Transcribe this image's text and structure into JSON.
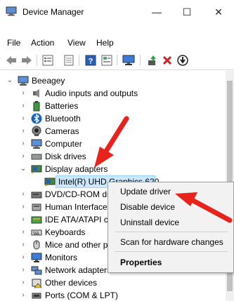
{
  "window": {
    "title": "Device Manager",
    "minimize": "—",
    "maximize": "☐",
    "close": "✕"
  },
  "menu": [
    "File",
    "Action",
    "View",
    "Help"
  ],
  "toolbar": {
    "icons": [
      "back-icon",
      "forward-icon",
      "properties-icon",
      "scan-icon",
      "help-icon",
      "details-icon",
      "monitor-icon",
      "update-driver-icon",
      "uninstall-icon",
      "download-icon"
    ]
  },
  "tree": {
    "root": "Beeagey",
    "items": [
      {
        "label": "Audio inputs and outputs",
        "icon": "speaker-icon"
      },
      {
        "label": "Batteries",
        "icon": "battery-icon"
      },
      {
        "label": "Bluetooth",
        "icon": "bluetooth-icon"
      },
      {
        "label": "Cameras",
        "icon": "camera-icon"
      },
      {
        "label": "Computer",
        "icon": "computer-icon"
      },
      {
        "label": "Disk drives",
        "icon": "disk-icon"
      },
      {
        "label": "Display adapters",
        "icon": "display-adapter-icon",
        "expanded": true
      },
      {
        "label": "Intel(R) UHD Graphics 620",
        "icon": "display-adapter-icon",
        "child": true,
        "selected": true
      },
      {
        "label": "DVD/CD-ROM drives",
        "icon": "dvd-icon"
      },
      {
        "label": "Human Interface Devices",
        "icon": "hid-icon"
      },
      {
        "label": "IDE ATA/ATAPI controllers",
        "icon": "ide-icon"
      },
      {
        "label": "Keyboards",
        "icon": "keyboard-icon"
      },
      {
        "label": "Mice and other pointing devices",
        "icon": "mouse-icon"
      },
      {
        "label": "Monitors",
        "icon": "monitor-icon"
      },
      {
        "label": "Network adapters",
        "icon": "network-icon"
      },
      {
        "label": "Other devices",
        "icon": "other-devices-icon"
      },
      {
        "label": "Ports (COM & LPT)",
        "icon": "ports-icon"
      }
    ]
  },
  "context_menu": {
    "update_driver": "Update driver",
    "disable_device": "Disable device",
    "uninstall_device": "Uninstall device",
    "scan": "Scan for hardware changes",
    "properties": "Properties"
  },
  "colors": {
    "selection": "#cce8ff",
    "arrow": "#e8231c",
    "menu_bg": "#f2f2f2"
  }
}
